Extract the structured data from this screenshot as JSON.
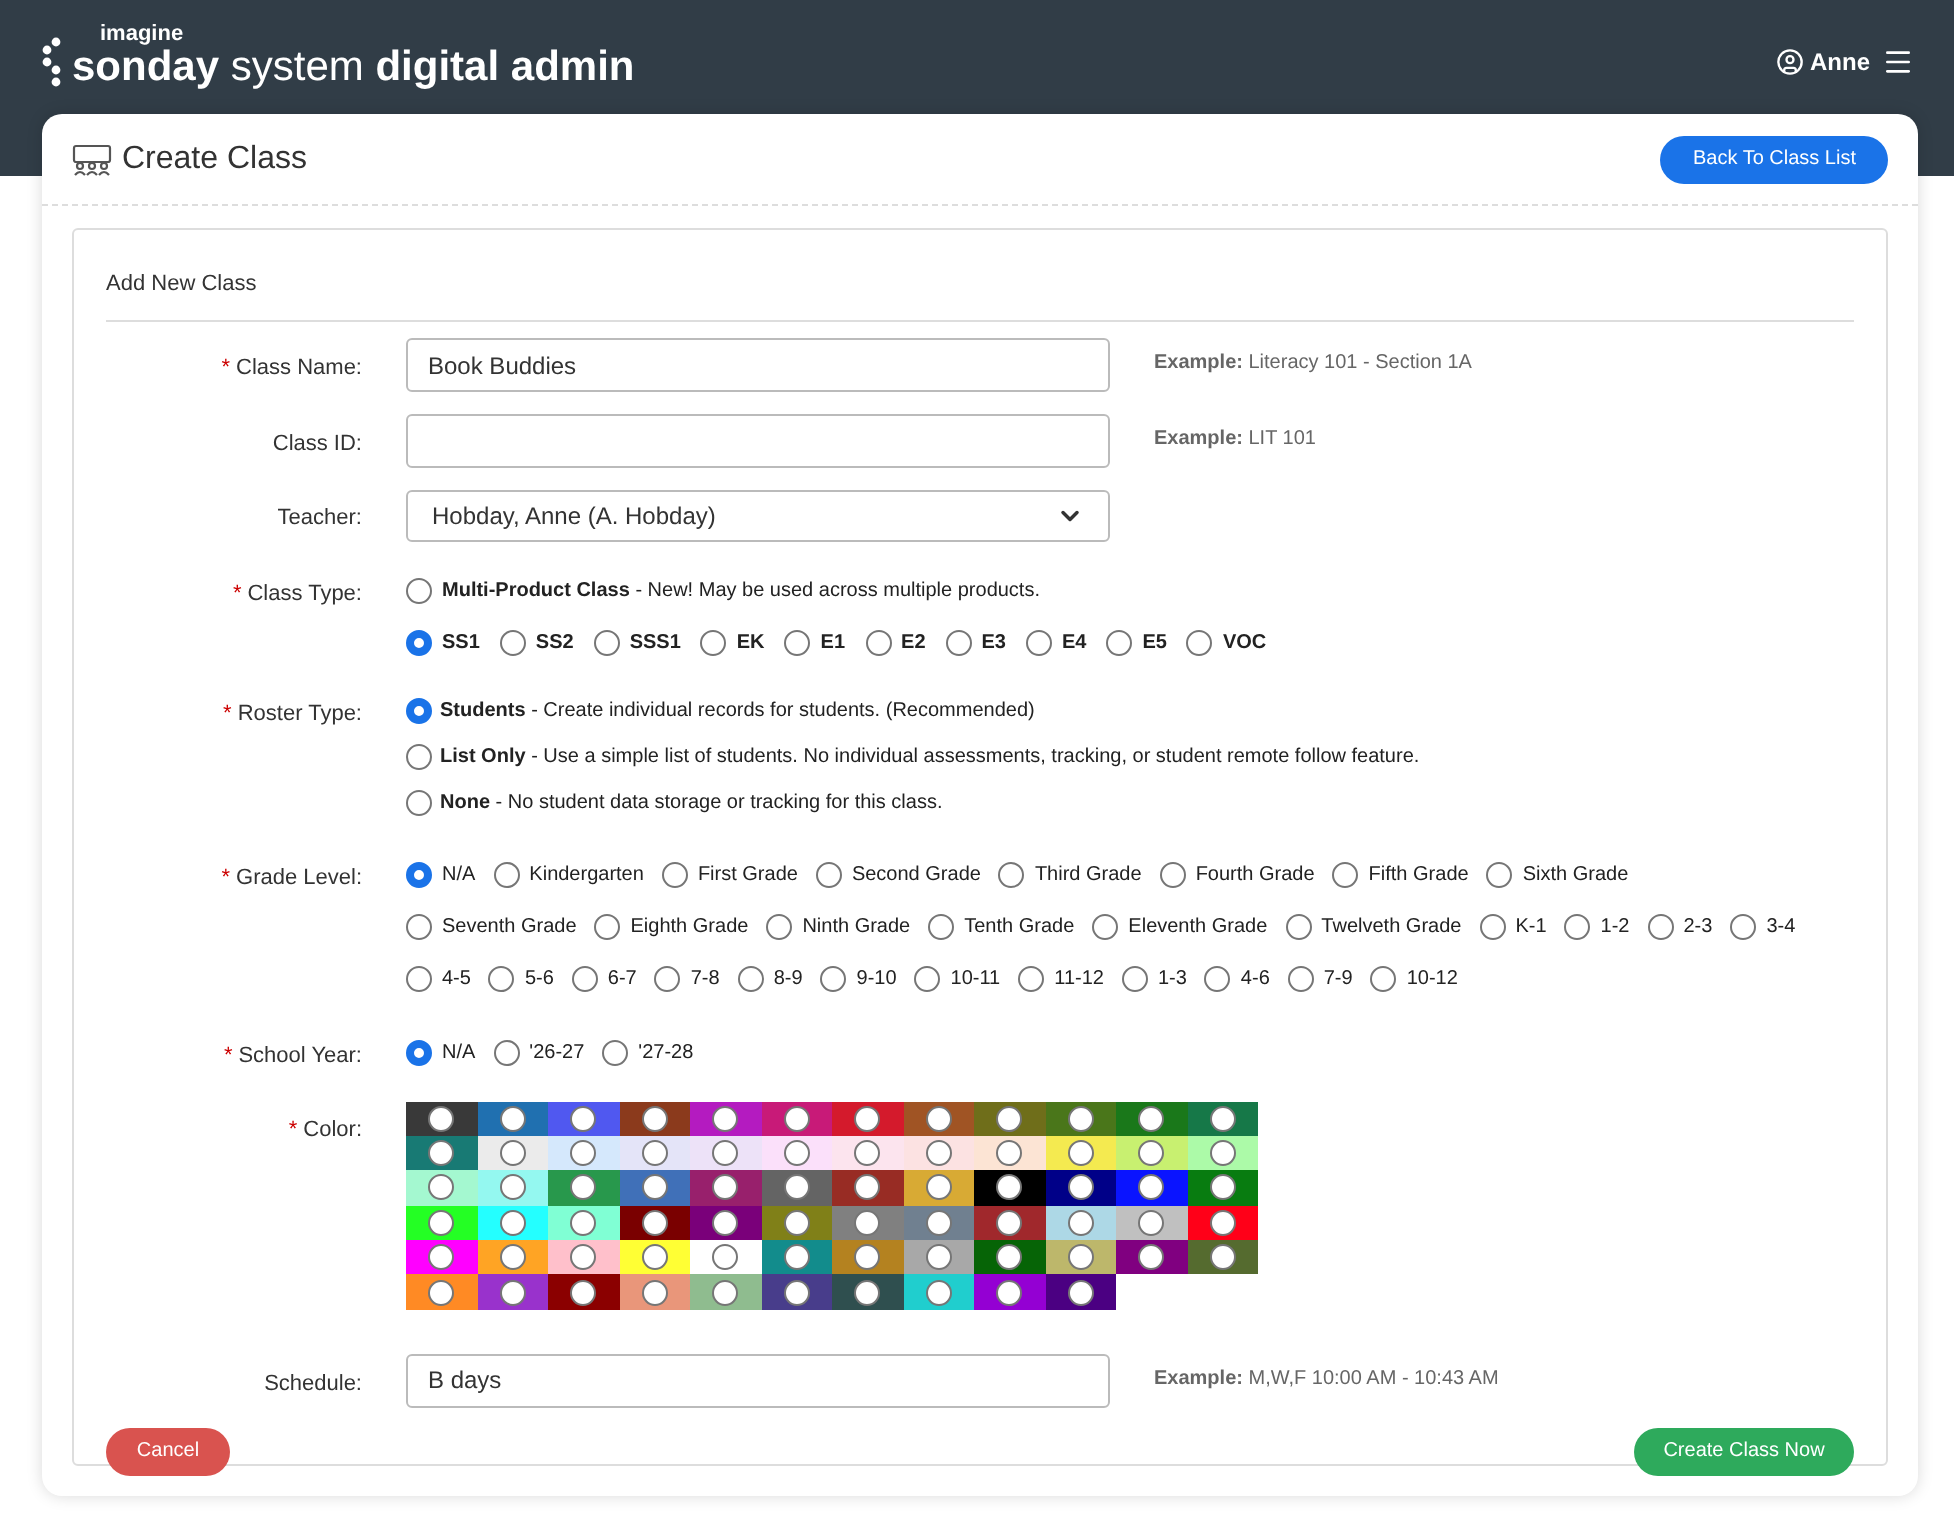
{
  "header": {
    "brand_small": "imagine",
    "brand_light": "sonday system",
    "brand_bold": "digital admin",
    "user": "Anne"
  },
  "page": {
    "title": "Create Class",
    "back_button": "Back To Class List"
  },
  "form": {
    "title": "Add New Class",
    "class_name": {
      "label": "Class Name:",
      "marker": "*",
      "value": "Book Buddies",
      "example_label": "Example:",
      "example": "Literacy 101 - Section 1A"
    },
    "class_id": {
      "label": "Class ID:",
      "example_label": "Example:",
      "example": "LIT 101"
    },
    "teacher": {
      "label": "Teacher:",
      "value": "Hobday, Anne (A. Hobday)"
    },
    "class_type": {
      "label": "Class Type:",
      "marker": "*",
      "multi": {
        "name": "Multi-Product Class",
        "description": "- New! May be used across multiple products.",
        "selected": false
      },
      "products": [
        {
          "label": "SS1",
          "selected": true
        },
        {
          "label": "SS2",
          "selected": false
        },
        {
          "label": "SSS1",
          "selected": false
        },
        {
          "label": "EK",
          "selected": false
        },
        {
          "label": "E1",
          "selected": false
        },
        {
          "label": "E2",
          "selected": false
        },
        {
          "label": "E3",
          "selected": false
        },
        {
          "label": "E4",
          "selected": false
        },
        {
          "label": "E5",
          "selected": false
        },
        {
          "label": "VOC",
          "selected": false
        }
      ]
    },
    "roster_type": {
      "label": "Roster Type:",
      "marker": "*",
      "options": [
        {
          "name": "Students",
          "description": "- Create individual records for students. (Recommended)",
          "selected": true
        },
        {
          "name": "List Only",
          "description": "- Use a simple list of students. No individual assessments, tracking, or student remote follow feature.",
          "selected": false
        },
        {
          "name": "None",
          "description": "- No student data storage or tracking for this class.",
          "selected": false
        }
      ]
    },
    "grade_level": {
      "label": "Grade Level:",
      "marker": "*",
      "options": [
        {
          "label": "N/A",
          "selected": true
        },
        {
          "label": "Kindergarten",
          "selected": false
        },
        {
          "label": "First Grade",
          "selected": false
        },
        {
          "label": "Second Grade",
          "selected": false
        },
        {
          "label": "Third Grade",
          "selected": false
        },
        {
          "label": "Fourth Grade",
          "selected": false
        },
        {
          "label": "Fifth Grade",
          "selected": false
        },
        {
          "label": "Sixth Grade",
          "selected": false
        },
        {
          "label": "Seventh Grade",
          "selected": false
        },
        {
          "label": "Eighth Grade",
          "selected": false
        },
        {
          "label": "Ninth Grade",
          "selected": false
        },
        {
          "label": "Tenth Grade",
          "selected": false
        },
        {
          "label": "Eleventh Grade",
          "selected": false
        },
        {
          "label": "Twelveth Grade",
          "selected": false
        },
        {
          "label": "K-1",
          "selected": false
        },
        {
          "label": "1-2",
          "selected": false
        },
        {
          "label": "2-3",
          "selected": false
        },
        {
          "label": "3-4",
          "selected": false
        },
        {
          "label": "4-5",
          "selected": false
        },
        {
          "label": "5-6",
          "selected": false
        },
        {
          "label": "6-7",
          "selected": false
        },
        {
          "label": "7-8",
          "selected": false
        },
        {
          "label": "8-9",
          "selected": false
        },
        {
          "label": "9-10",
          "selected": false
        },
        {
          "label": "10-11",
          "selected": false
        },
        {
          "label": "11-12",
          "selected": false
        },
        {
          "label": "1-3",
          "selected": false
        },
        {
          "label": "4-6",
          "selected": false
        },
        {
          "label": "7-9",
          "selected": false
        },
        {
          "label": "10-12",
          "selected": false
        }
      ]
    },
    "school_year": {
      "label": "School Year:",
      "marker": "*",
      "options": [
        {
          "label": "N/A",
          "selected": true
        },
        {
          "label": "'26-27",
          "selected": false
        },
        {
          "label": "'27-28",
          "selected": false
        }
      ]
    },
    "color": {
      "label": "Color:",
      "marker": "*",
      "swatches": [
        {
          "color": "#393939",
          "selected": false
        },
        {
          "color": "#2070b0",
          "selected": false
        },
        {
          "color": "#5058f0",
          "selected": false
        },
        {
          "color": "#8b3a1c",
          "selected": false
        },
        {
          "color": "#b41bc0",
          "selected": false
        },
        {
          "color": "#c81a78",
          "selected": false
        },
        {
          "color": "#d41a2c",
          "selected": false
        },
        {
          "color": "#a05424",
          "selected": false
        },
        {
          "color": "#6f6e1a",
          "selected": false
        },
        {
          "color": "#4a761a",
          "selected": false
        },
        {
          "color": "#1a781a",
          "selected": false
        },
        {
          "color": "#167848",
          "selected": false
        },
        {
          "color": "#187a74",
          "selected": false
        },
        {
          "color": "#ebebeb",
          "selected": false
        },
        {
          "color": "#d5e8fc",
          "selected": false
        },
        {
          "color": "#e4e4f8",
          "selected": false
        },
        {
          "color": "#ede2f8",
          "selected": false
        },
        {
          "color": "#fbe0fa",
          "selected": false
        },
        {
          "color": "#fce4ee",
          "selected": false
        },
        {
          "color": "#fce2e2",
          "selected": false
        },
        {
          "color": "#fce4d4",
          "selected": false
        },
        {
          "color": "#f4ea50",
          "selected": false
        },
        {
          "color": "#c8f070",
          "selected": false
        },
        {
          "color": "#acfaa8",
          "selected": false
        },
        {
          "color": "#a4f8d0",
          "selected": false
        },
        {
          "color": "#94f8f0",
          "selected": false
        },
        {
          "color": "#28984c",
          "selected": false
        },
        {
          "color": "#4070b8",
          "selected": false
        },
        {
          "color": "#98206c",
          "selected": false
        },
        {
          "color": "#646464",
          "selected": false
        },
        {
          "color": "#982c24",
          "selected": false
        },
        {
          "color": "#d8aa34",
          "selected": false
        },
        {
          "color": "#000000",
          "selected": false
        },
        {
          "color": "#000088",
          "selected": false
        },
        {
          "color": "#0a14ff",
          "selected": false
        },
        {
          "color": "#087c10",
          "selected": false
        },
        {
          "color": "#24ff24",
          "selected": false
        },
        {
          "color": "#24ffff",
          "selected": false
        },
        {
          "color": "#80ffd4",
          "selected": false
        },
        {
          "color": "#7a0000",
          "selected": false
        },
        {
          "color": "#7a007a",
          "selected": false
        },
        {
          "color": "#808018",
          "selected": false
        },
        {
          "color": "#808080",
          "selected": false
        },
        {
          "color": "#708090",
          "selected": false
        },
        {
          "color": "#a0282c",
          "selected": false
        },
        {
          "color": "#add8e6",
          "selected": false
        },
        {
          "color": "#c0c0c0",
          "selected": false
        },
        {
          "color": "#ff0018",
          "selected": false
        },
        {
          "color": "#ff00ff",
          "selected": false
        },
        {
          "color": "#ffa424",
          "selected": false
        },
        {
          "color": "#ffc0cb",
          "selected": false
        },
        {
          "color": "#ffff34",
          "selected": false
        },
        {
          "color": "#ffffff",
          "selected": false
        },
        {
          "color": "#128c8c",
          "selected": false
        },
        {
          "color": "#b48220",
          "selected": false
        },
        {
          "color": "#a8a8a8",
          "selected": false
        },
        {
          "color": "#066406",
          "selected": false
        },
        {
          "color": "#bdb76b",
          "selected": false
        },
        {
          "color": "#800080",
          "selected": false
        },
        {
          "color": "#556b2f",
          "selected": false
        },
        {
          "color": "#ff8a24",
          "selected": false
        },
        {
          "color": "#9932cc",
          "selected": false
        },
        {
          "color": "#8b0000",
          "selected": false
        },
        {
          "color": "#e9967a",
          "selected": false
        },
        {
          "color": "#8fbc8f",
          "selected": false
        },
        {
          "color": "#483d8b",
          "selected": false
        },
        {
          "color": "#2f4f4f",
          "selected": false
        },
        {
          "color": "#20cece",
          "selected": false
        },
        {
          "color": "#9400d3",
          "selected": false
        },
        {
          "color": "#4b0082",
          "selected": false
        }
      ]
    },
    "schedule": {
      "label": "Schedule:",
      "value": "B days",
      "example_label": "Example:",
      "example": "M,W,F 10:00 AM - 10:43 AM"
    },
    "cancel_button": "Cancel",
    "submit_button": "Create Class Now"
  }
}
